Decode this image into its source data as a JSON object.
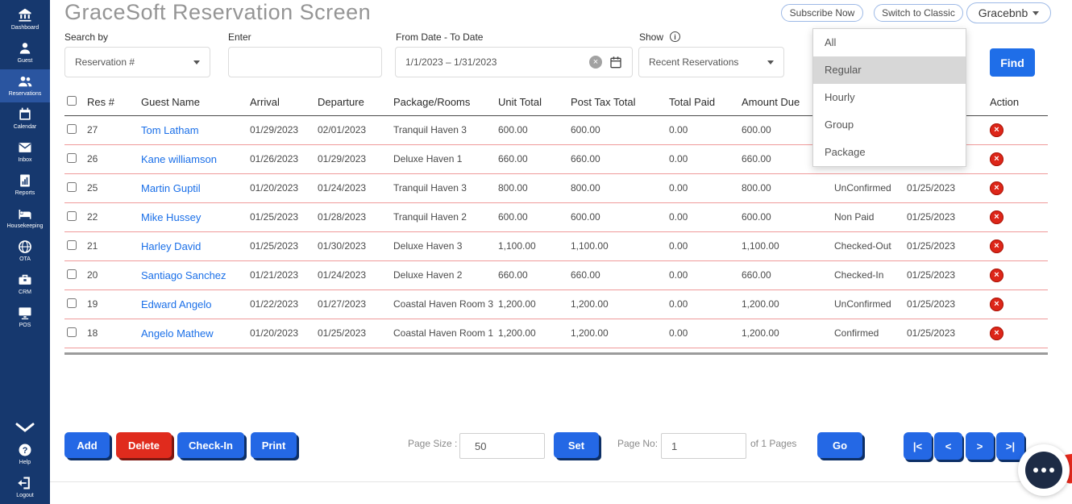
{
  "app": {
    "title": "GraceSoft Reservation Screen"
  },
  "colors": {
    "accent_blue": "#1f6ee8",
    "button_blue": "#2468e5",
    "danger_red": "#e02b1d",
    "sidebar_navy": "#16386e",
    "link_blue": "#1a6fe8",
    "row_divider_red": "#ef9a9a"
  },
  "topbar": {
    "subscribe": "Subscribe Now",
    "switch_classic": "Switch to Classic",
    "account": "Gracebnb"
  },
  "sidebar": {
    "items": [
      {
        "label": "Dashboard"
      },
      {
        "label": "Guest"
      },
      {
        "label": "Reservations"
      },
      {
        "label": "Calendar"
      },
      {
        "label": "Inbox"
      },
      {
        "label": "Reports"
      },
      {
        "label": "Housekeeping"
      },
      {
        "label": "OTA"
      },
      {
        "label": "CRM"
      },
      {
        "label": "POS"
      },
      {
        "label": ""
      },
      {
        "label": "Help"
      },
      {
        "label": "Logout"
      }
    ]
  },
  "filters": {
    "search_by_label": "Search by",
    "search_by_value": "Reservation #",
    "enter_label": "Enter",
    "enter_value": "",
    "date_label": "From Date - To Date",
    "date_value": "1/1/2023 – 1/31/2023",
    "show_label": "Show",
    "show_value": "Recent Reservations",
    "find_label": "Find"
  },
  "type_dropdown": {
    "options": [
      {
        "label": "All",
        "highlighted": false
      },
      {
        "label": "Regular",
        "highlighted": true
      },
      {
        "label": "Hourly",
        "highlighted": false
      },
      {
        "label": "Group",
        "highlighted": false
      },
      {
        "label": "Package",
        "highlighted": false
      }
    ]
  },
  "table": {
    "headers": {
      "res": "Res #",
      "guest": "Guest Name",
      "arrival": "Arrival",
      "departure": "Departure",
      "package": "Package/Rooms",
      "unit": "Unit Total",
      "posttax": "Post Tax Total",
      "paid": "Total Paid",
      "due": "Amount Due",
      "status": "",
      "booked": "",
      "action": "Action"
    },
    "rows": [
      {
        "res": "27",
        "guest": "Tom Latham",
        "arrival": "01/29/2023",
        "departure": "02/01/2023",
        "package": "Tranquil Haven 3",
        "unit": "600.00",
        "posttax": "600.00",
        "paid": "0.00",
        "due": "600.00",
        "status": "",
        "booked": ""
      },
      {
        "res": "26",
        "guest": "Kane williamson",
        "arrival": "01/26/2023",
        "departure": "01/29/2023",
        "package": "Deluxe Haven 1",
        "unit": "660.00",
        "posttax": "660.00",
        "paid": "0.00",
        "due": "660.00",
        "status": "",
        "booked": ""
      },
      {
        "res": "25",
        "guest": "Martin Guptil",
        "arrival": "01/20/2023",
        "departure": "01/24/2023",
        "package": "Tranquil Haven 3",
        "unit": "800.00",
        "posttax": "800.00",
        "paid": "0.00",
        "due": "800.00",
        "status": "UnConfirmed",
        "booked": "01/25/2023"
      },
      {
        "res": "22",
        "guest": "Mike Hussey",
        "arrival": "01/25/2023",
        "departure": "01/28/2023",
        "package": "Tranquil Haven 2",
        "unit": "600.00",
        "posttax": "600.00",
        "paid": "0.00",
        "due": "600.00",
        "status": "Non Paid",
        "booked": "01/25/2023"
      },
      {
        "res": "21",
        "guest": "Harley David",
        "arrival": "01/25/2023",
        "departure": "01/30/2023",
        "package": "Deluxe Haven 3",
        "unit": "1,100.00",
        "posttax": "1,100.00",
        "paid": "0.00",
        "due": "1,100.00",
        "status": "Checked-Out",
        "booked": "01/25/2023"
      },
      {
        "res": "20",
        "guest": "Santiago Sanchez",
        "arrival": "01/21/2023",
        "departure": "01/24/2023",
        "package": "Deluxe Haven 2",
        "unit": "660.00",
        "posttax": "660.00",
        "paid": "0.00",
        "due": "660.00",
        "status": "Checked-In",
        "booked": "01/25/2023"
      },
      {
        "res": "19",
        "guest": "Edward Angelo",
        "arrival": "01/22/2023",
        "departure": "01/27/2023",
        "package": "Coastal Haven Room 3",
        "unit": "1,200.00",
        "posttax": "1,200.00",
        "paid": "0.00",
        "due": "1,200.00",
        "status": "UnConfirmed",
        "booked": "01/25/2023"
      },
      {
        "res": "18",
        "guest": "Angelo Mathew",
        "arrival": "01/20/2023",
        "departure": "01/25/2023",
        "package": "Coastal Haven Room 1",
        "unit": "1,200.00",
        "posttax": "1,200.00",
        "paid": "0.00",
        "due": "1,200.00",
        "status": "Confirmed",
        "booked": "01/25/2023"
      }
    ]
  },
  "footer": {
    "add": "Add",
    "delete": "Delete",
    "checkin": "Check-In",
    "print": "Print",
    "page_size_label": "Page Size :",
    "page_size_value": "50",
    "set": "Set",
    "page_no_label": "Page No:",
    "page_no_value": "1",
    "pages_text": "of 1 Pages",
    "go": "Go",
    "pager": {
      "first": "|<",
      "prev": "<",
      "next": ">",
      "last": ">|"
    }
  }
}
